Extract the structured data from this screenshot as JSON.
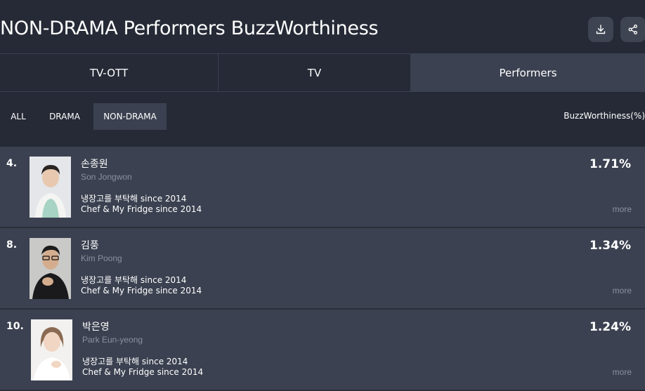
{
  "header": {
    "title": "NON-DRAMA Performers BuzzWorthiness",
    "download_icon": "download-icon",
    "share_icon": "share-icon"
  },
  "tabs": [
    {
      "label": "TV-OTT",
      "active": false
    },
    {
      "label": "TV",
      "active": false
    },
    {
      "label": "Performers",
      "active": true
    }
  ],
  "filters": [
    {
      "label": "ALL",
      "active": false
    },
    {
      "label": "DRAMA",
      "active": false
    },
    {
      "label": "NON-DRAMA",
      "active": true
    }
  ],
  "metric_label": "BuzzWorthiness(%)",
  "performers": [
    {
      "rank": "4.",
      "name": "손종원",
      "english_name": "Son Jongwon",
      "program_korean": "냉장고를 부탁해 since 2014",
      "program_english": "Chef & My Fridge since 2014",
      "buzz": "1.71%",
      "more": "more"
    },
    {
      "rank": "8.",
      "name": "김풍",
      "english_name": "Kim Poong",
      "program_korean": "냉장고를 부탁해 since 2014",
      "program_english": "Chef & My Fridge since 2014",
      "buzz": "1.34%",
      "more": "more"
    },
    {
      "rank": "10.",
      "name": "박은영",
      "english_name": "Park Eun-yeong",
      "program_korean": "냉장고를 부탁해 since 2014",
      "program_english": "Chef & My Fridge since 2014",
      "buzz": "1.24%",
      "more": "more"
    }
  ],
  "colors": {
    "background": "#252a36",
    "active": "#3b4150",
    "muted_text": "#8a90a0"
  }
}
